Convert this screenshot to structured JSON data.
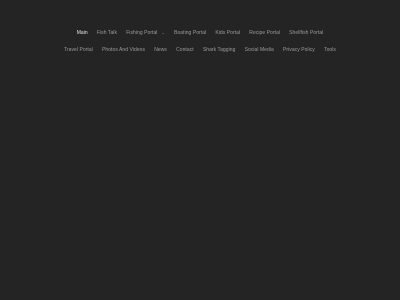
{
  "nav": {
    "row1": [
      {
        "label": "Main",
        "active": true
      },
      {
        "label": "Fish Talk"
      },
      {
        "label": "Fishing Portal",
        "has_dropdown": true
      },
      {
        "label": "Boating Portal"
      },
      {
        "label": "Kids Portal"
      },
      {
        "label": "Recipe Portal"
      },
      {
        "label": "Shellfish Portal"
      }
    ],
    "row2": [
      {
        "label": "Travel Portal"
      },
      {
        "label": "Photos And Videos"
      },
      {
        "label": "News"
      },
      {
        "label": "Contact"
      },
      {
        "label": "Shark Tagging"
      },
      {
        "label": "Social Media"
      },
      {
        "label": "Privacy Policy"
      },
      {
        "label": "Tools"
      }
    ],
    "dropdown_icon": "chevron-down-icon"
  },
  "colors": {
    "background": "#242424",
    "nav_text": "#9c9c9c",
    "nav_active": "#e6e6e6"
  }
}
